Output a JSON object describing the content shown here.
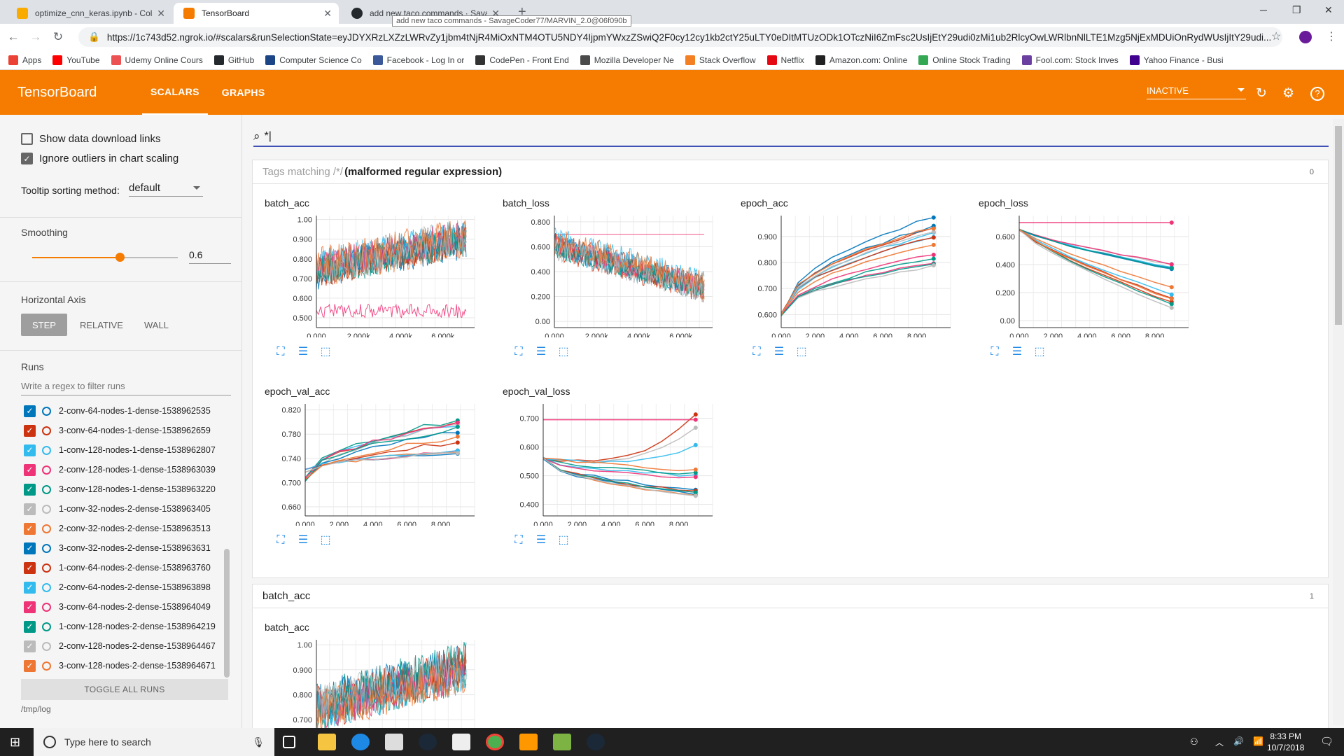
{
  "browser": {
    "tabs": [
      {
        "label": "optimize_cnn_keras.ipynb - Cola",
        "active": false,
        "icon_color": "#f9ab00"
      },
      {
        "label": "TensorBoard",
        "active": true,
        "icon_color": "#f57c00"
      },
      {
        "label": "add new taco commands · Savag",
        "active": false,
        "icon_color": "#24292e"
      }
    ],
    "tab_tooltip": "add new taco commands - SavageCoder77/MARVIN_2.0@06f090b",
    "url": "https://1c743d52.ngrok.io/#scalars&runSelectionState=eyJDYXRzLXZzLWRvZy1jbm4tNjR4MiOxNTM4OTU5NDY4IjpmYWxzZSwiQ2F0cy12cy1kb2ctY25uLTY0eDItMTUzODk1OTczNiI6ZmFsc2UsIjEtY29udi0zMi1ub2RlcyOwLWRlbnNlLTE1Mzg5NjExMDUiOnRydWUsIjItY29udi...",
    "bookmarks": [
      {
        "label": "Apps",
        "color": "#ea4335"
      },
      {
        "label": "YouTube",
        "color": "#ff0000"
      },
      {
        "label": "Udemy Online Cours",
        "color": "#ec5252"
      },
      {
        "label": "GitHub",
        "color": "#24292e"
      },
      {
        "label": "Computer Science Co",
        "color": "#1c4587"
      },
      {
        "label": "Facebook - Log In or",
        "color": "#3b5998"
      },
      {
        "label": "CodePen - Front End",
        "color": "#333333"
      },
      {
        "label": "Mozilla Developer Ne",
        "color": "#4a4a4a"
      },
      {
        "label": "Stack Overflow",
        "color": "#f48024"
      },
      {
        "label": "Netflix",
        "color": "#e50914"
      },
      {
        "label": "Amazon.com: Online",
        "color": "#222222"
      },
      {
        "label": "Online Stock Trading",
        "color": "#34a853"
      },
      {
        "label": "Fool.com: Stock Inves",
        "color": "#6b3fa0"
      },
      {
        "label": "Yahoo Finance - Busi",
        "color": "#400090"
      }
    ]
  },
  "header": {
    "title": "TensorBoard",
    "tabs": [
      "SCALARS",
      "GRAPHS"
    ],
    "run_status": "INACTIVE",
    "accent": "#f57c00"
  },
  "sidebar": {
    "show_download": "Show data download links",
    "ignore_outliers": "Ignore outliers in chart scaling",
    "tooltip_label": "Tooltip sorting method:",
    "tooltip_value": "default",
    "smoothing_label": "Smoothing",
    "smoothing_value": "0.6",
    "smoothing_fraction": 0.6,
    "haxis_label": "Horizontal Axis",
    "haxis_options": [
      "STEP",
      "RELATIVE",
      "WALL"
    ],
    "runs_label": "Runs",
    "runs_filter_placeholder": "Write a regex to filter runs",
    "runs": [
      {
        "name": "2-conv-64-nodes-1-dense-1538962535",
        "color": "#0077bb"
      },
      {
        "name": "3-conv-64-nodes-1-dense-1538962659",
        "color": "#cc3311"
      },
      {
        "name": "1-conv-128-nodes-1-dense-1538962807",
        "color": "#33bbee"
      },
      {
        "name": "2-conv-128-nodes-1-dense-1538963039",
        "color": "#ee3377"
      },
      {
        "name": "3-conv-128-nodes-1-dense-1538963220",
        "color": "#009988"
      },
      {
        "name": "1-conv-32-nodes-2-dense-1538963405",
        "color": "#bbbbbb"
      },
      {
        "name": "2-conv-32-nodes-2-dense-1538963513",
        "color": "#ee7733"
      },
      {
        "name": "3-conv-32-nodes-2-dense-1538963631",
        "color": "#0077bb"
      },
      {
        "name": "1-conv-64-nodes-2-dense-1538963760",
        "color": "#cc3311"
      },
      {
        "name": "2-conv-64-nodes-2-dense-1538963898",
        "color": "#33bbee"
      },
      {
        "name": "3-conv-64-nodes-2-dense-1538964049",
        "color": "#ee3377"
      },
      {
        "name": "1-conv-128-nodes-2-dense-1538964219",
        "color": "#009988"
      },
      {
        "name": "2-conv-128-nodes-2-dense-1538964467",
        "color": "#bbbbbb"
      },
      {
        "name": "3-conv-128-nodes-2-dense-1538964671",
        "color": "#ee7733"
      }
    ],
    "toggle_all": "TOGGLE ALL RUNS",
    "logdir": "/tmp/log"
  },
  "main": {
    "search_value": "*|",
    "group1_prefix": "Tags matching /*/",
    "group1_error": "(malformed regular expression)",
    "group1_count": "0",
    "group2_title": "batch_acc",
    "group2_count": "1"
  },
  "chart_data": [
    {
      "type": "line",
      "title": "batch_acc",
      "xticks": [
        "0.000",
        "2.000k",
        "4.000k",
        "6.000k"
      ],
      "yticks": [
        "1.00",
        "0.900",
        "0.800",
        "0.700",
        "0.600",
        "0.500"
      ],
      "xlim": [
        0,
        7500
      ],
      "ylim": [
        0.45,
        1.02
      ]
    },
    {
      "type": "line",
      "title": "batch_loss",
      "xticks": [
        "0.000",
        "2.000k",
        "4.000k",
        "6.000k"
      ],
      "yticks": [
        "0.800",
        "0.600",
        "0.400",
        "0.200",
        "0.00"
      ],
      "xlim": [
        0,
        7500
      ],
      "ylim": [
        -0.05,
        0.85
      ]
    },
    {
      "type": "line",
      "title": "epoch_acc",
      "xticks": [
        "0.000",
        "2.000",
        "4.000",
        "6.000",
        "8.000"
      ],
      "yticks": [
        "0.900",
        "0.800",
        "0.700",
        "0.600"
      ],
      "xlim": [
        0,
        10
      ],
      "ylim": [
        0.55,
        0.98
      ]
    },
    {
      "type": "line",
      "title": "epoch_loss",
      "xticks": [
        "0.000",
        "2.000",
        "4.000",
        "6.000",
        "8.000"
      ],
      "yticks": [
        "0.600",
        "0.400",
        "0.200",
        "0.00"
      ],
      "xlim": [
        0,
        10
      ],
      "ylim": [
        -0.05,
        0.75
      ]
    },
    {
      "type": "line",
      "title": "epoch_val_acc",
      "xticks": [
        "0.000",
        "2.000",
        "4.000",
        "6.000",
        "8.000"
      ],
      "yticks": [
        "0.820",
        "0.780",
        "0.740",
        "0.700",
        "0.660"
      ],
      "xlim": [
        0,
        10
      ],
      "ylim": [
        0.645,
        0.83
      ]
    },
    {
      "type": "line",
      "title": "epoch_val_loss",
      "xticks": [
        "0.000",
        "2.000",
        "4.000",
        "6.000",
        "8.000"
      ],
      "yticks": [
        "0.700",
        "0.600",
        "0.500",
        "0.400"
      ],
      "xlim": [
        0,
        10
      ],
      "ylim": [
        0.36,
        0.75
      ]
    },
    {
      "type": "line",
      "title": "batch_acc",
      "xticks": [],
      "yticks": [
        "1.00",
        "0.900",
        "0.800",
        "0.700"
      ],
      "xlim": [
        0,
        7500
      ],
      "ylim": [
        0.65,
        1.02
      ]
    }
  ],
  "taskbar": {
    "search_placeholder": "Type here to search",
    "time": "8:33 PM",
    "date": "10/7/2018"
  }
}
